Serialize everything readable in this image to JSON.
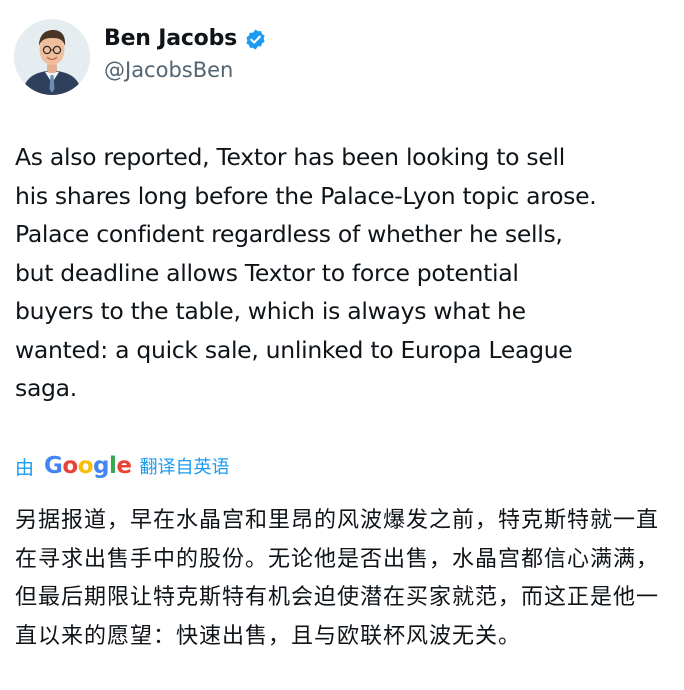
{
  "author": {
    "display_name": "Ben Jacobs",
    "handle": "@JacobsBen",
    "avatar_icon": "avatar-photo",
    "verified_icon": "verified-badge-icon",
    "verified_color": "#1d9bf0"
  },
  "tweet": {
    "text": "As also reported, Textor has been looking to sell\nhis shares long before the Palace-Lyon topic arose.\nPalace confident regardless of whether he sells,\nbut deadline allows Textor to force potential\nbuyers to the table, which is always what he\nwanted: a quick sale, unlinked to Europa League\nsaga."
  },
  "translation": {
    "by_label": "由",
    "provider_letters": [
      "G",
      "o",
      "o",
      "g",
      "l",
      "e"
    ],
    "provider_colors": [
      "#4285f4",
      "#ea4335",
      "#fbbc05",
      "#4285f4",
      "#34a853",
      "#ea4335"
    ],
    "link_label": "翻译自英语",
    "link_color": "#1d9bf0",
    "text": "另据报道，早在水晶宫和里昂的风波爆发之前，特克斯特就一直在寻求出售手中的股份。无论他是否出售，水晶宫都信心满满，但最后期限让特克斯特有机会迫使潜在买家就范，而这正是他一直以来的愿望：快速出售，且与欧联杯风波无关。"
  }
}
